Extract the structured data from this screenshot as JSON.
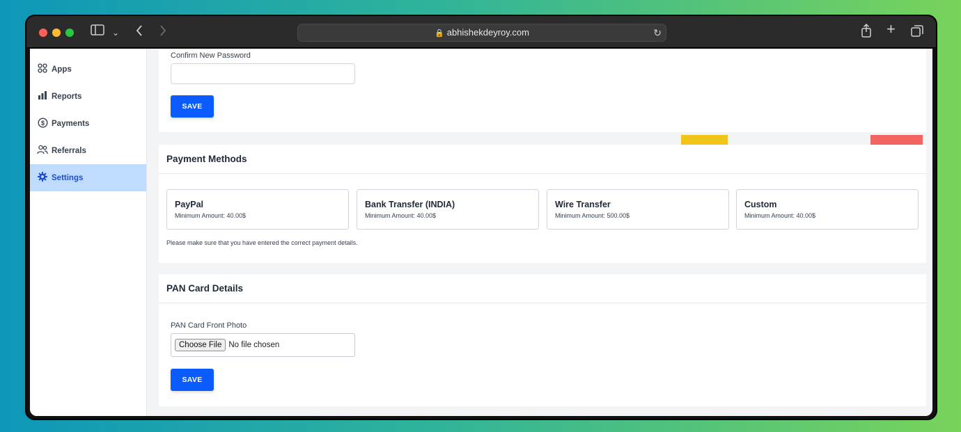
{
  "browser": {
    "url": "abhishekdeyroy.com"
  },
  "sidebar": {
    "items": [
      {
        "label": "Apps",
        "icon": "apps-grid-icon"
      },
      {
        "label": "Reports",
        "icon": "bar-chart-icon"
      },
      {
        "label": "Payments",
        "icon": "dollar-circle-icon"
      },
      {
        "label": "Referrals",
        "icon": "users-icon"
      },
      {
        "label": "Settings",
        "icon": "gear-icon",
        "active": true
      }
    ]
  },
  "password_section": {
    "confirm_label": "Confirm New Password",
    "confirm_value": "",
    "save_label": "SAVE"
  },
  "payment_methods": {
    "title": "Payment Methods",
    "methods": [
      {
        "name": "PayPal",
        "minimum": "Minimum Amount: 40.00$"
      },
      {
        "name": "Bank Transfer (INDIA)",
        "minimum": "Minimum Amount: 40.00$"
      },
      {
        "name": "Wire Transfer",
        "minimum": "Minimum Amount: 500.00$"
      },
      {
        "name": "Custom",
        "minimum": "Minimum Amount: 40.00$"
      }
    ],
    "note": "Please make sure that you have entered the correct payment details."
  },
  "pan_section": {
    "title": "PAN Card Details",
    "front_label": "PAN Card Front Photo",
    "choose_label": "Choose File",
    "file_status": "No file chosen",
    "save_label": "SAVE"
  },
  "colors": {
    "accent": "#0b5cff",
    "sidebar_active_bg": "#bfdbfe",
    "block_yellow": "#f0c419",
    "block_red": "#f2645f"
  }
}
